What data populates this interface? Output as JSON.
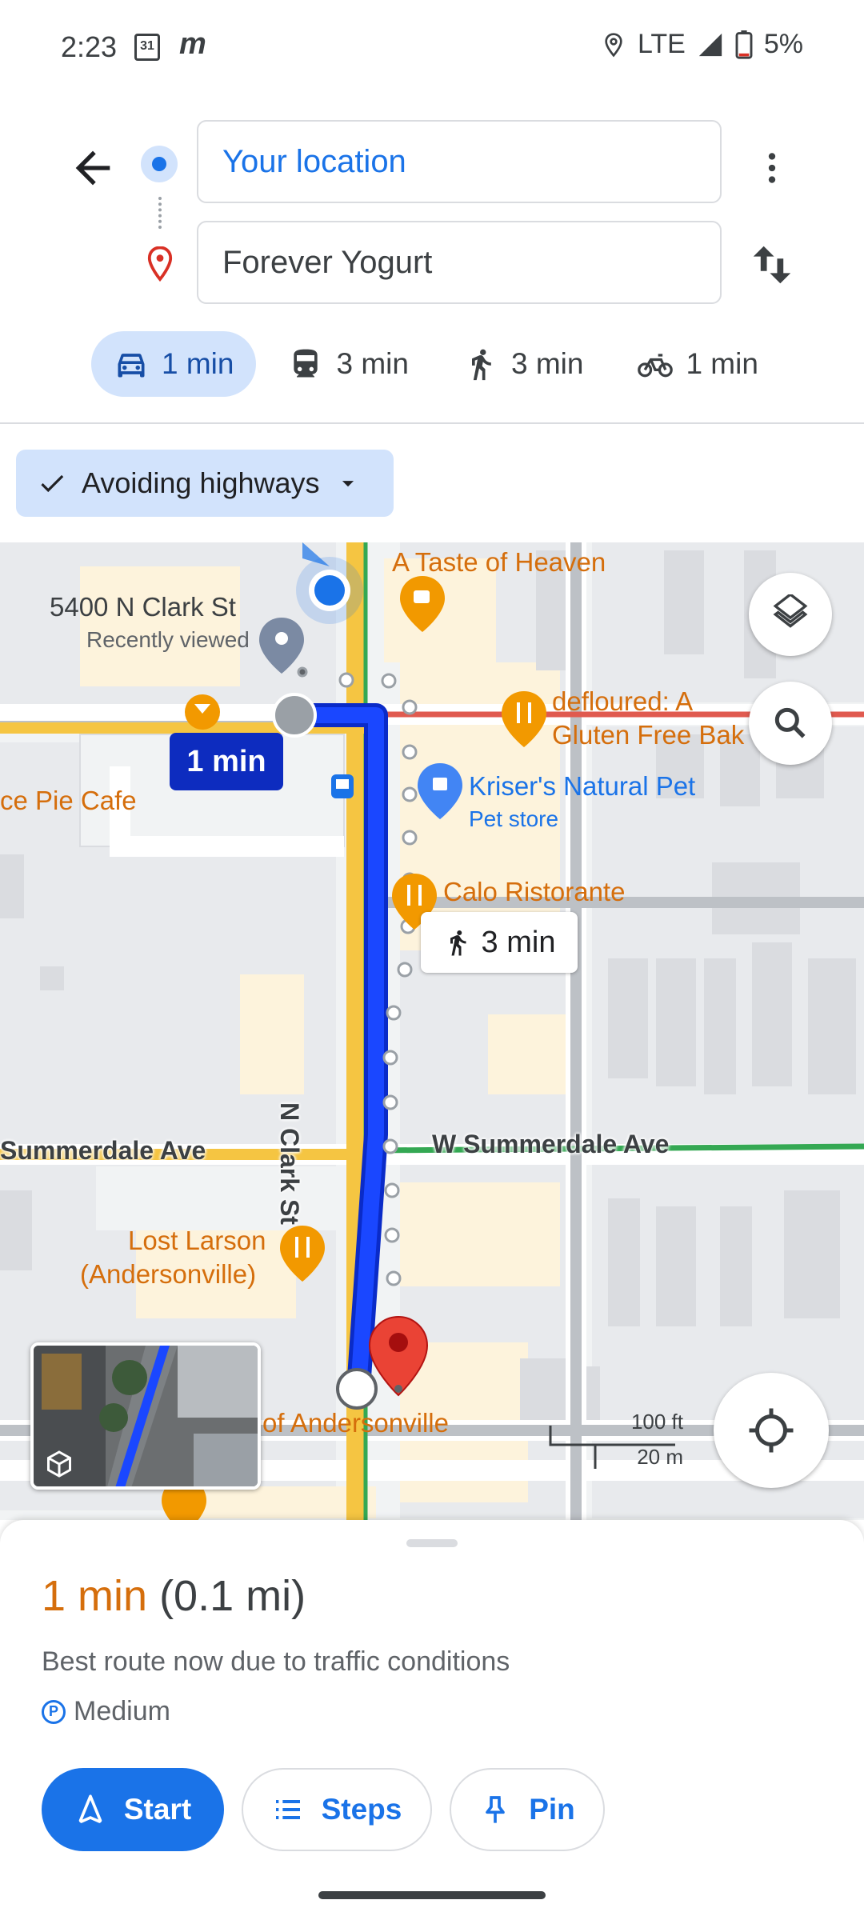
{
  "status_bar": {
    "time": "2:23",
    "calendar_day": "31",
    "app_glyph": "m",
    "network": "LTE",
    "battery": "5%"
  },
  "directions": {
    "origin": "Your location",
    "destination": "Forever Yogurt",
    "modes": [
      {
        "icon": "car-icon",
        "label": "1 min",
        "active": true
      },
      {
        "icon": "transit-icon",
        "label": "3 min",
        "active": false
      },
      {
        "icon": "walk-icon",
        "label": "3 min",
        "active": false
      },
      {
        "icon": "bike-icon",
        "label": "1 min",
        "active": false
      }
    ],
    "option_chip": "Avoiding highways"
  },
  "map": {
    "places": {
      "taste_of_heaven": "A Taste of Heaven",
      "clark_address": "5400 N Clark St",
      "recently_viewed": "Recently viewed",
      "defloured_1": "defloured: A",
      "defloured_2": "Gluten Free Bak",
      "krisers": "Kriser's Natural Pet",
      "pet_store": "Pet store",
      "pie_cafe": "ce Pie Cafe",
      "calo": "Calo Ristorante",
      "lost_larson_1": "Lost Larson",
      "lost_larson_2": "(Andersonville)",
      "andersonville": "of Andersonville"
    },
    "streets": {
      "summerdale_west": "Summerdale Ave",
      "summerdale_east": "W Summerdale Ave",
      "clark": "N Clark St"
    },
    "drive_eta": "1 min",
    "walk_eta": "3 min",
    "scale_ft": "100 ft",
    "scale_m": "20 m",
    "colors": {
      "route": "#1a47ff",
      "road_yellow": "#f5c542",
      "traffic_red": "#e05a4f",
      "traffic_green": "#34a853"
    }
  },
  "summary": {
    "time": "1 min",
    "distance": "(0.1 mi)",
    "description": "Best route now due to traffic conditions",
    "parking": "Medium",
    "start_label": "Start",
    "steps_label": "Steps",
    "pin_label": "Pin"
  }
}
